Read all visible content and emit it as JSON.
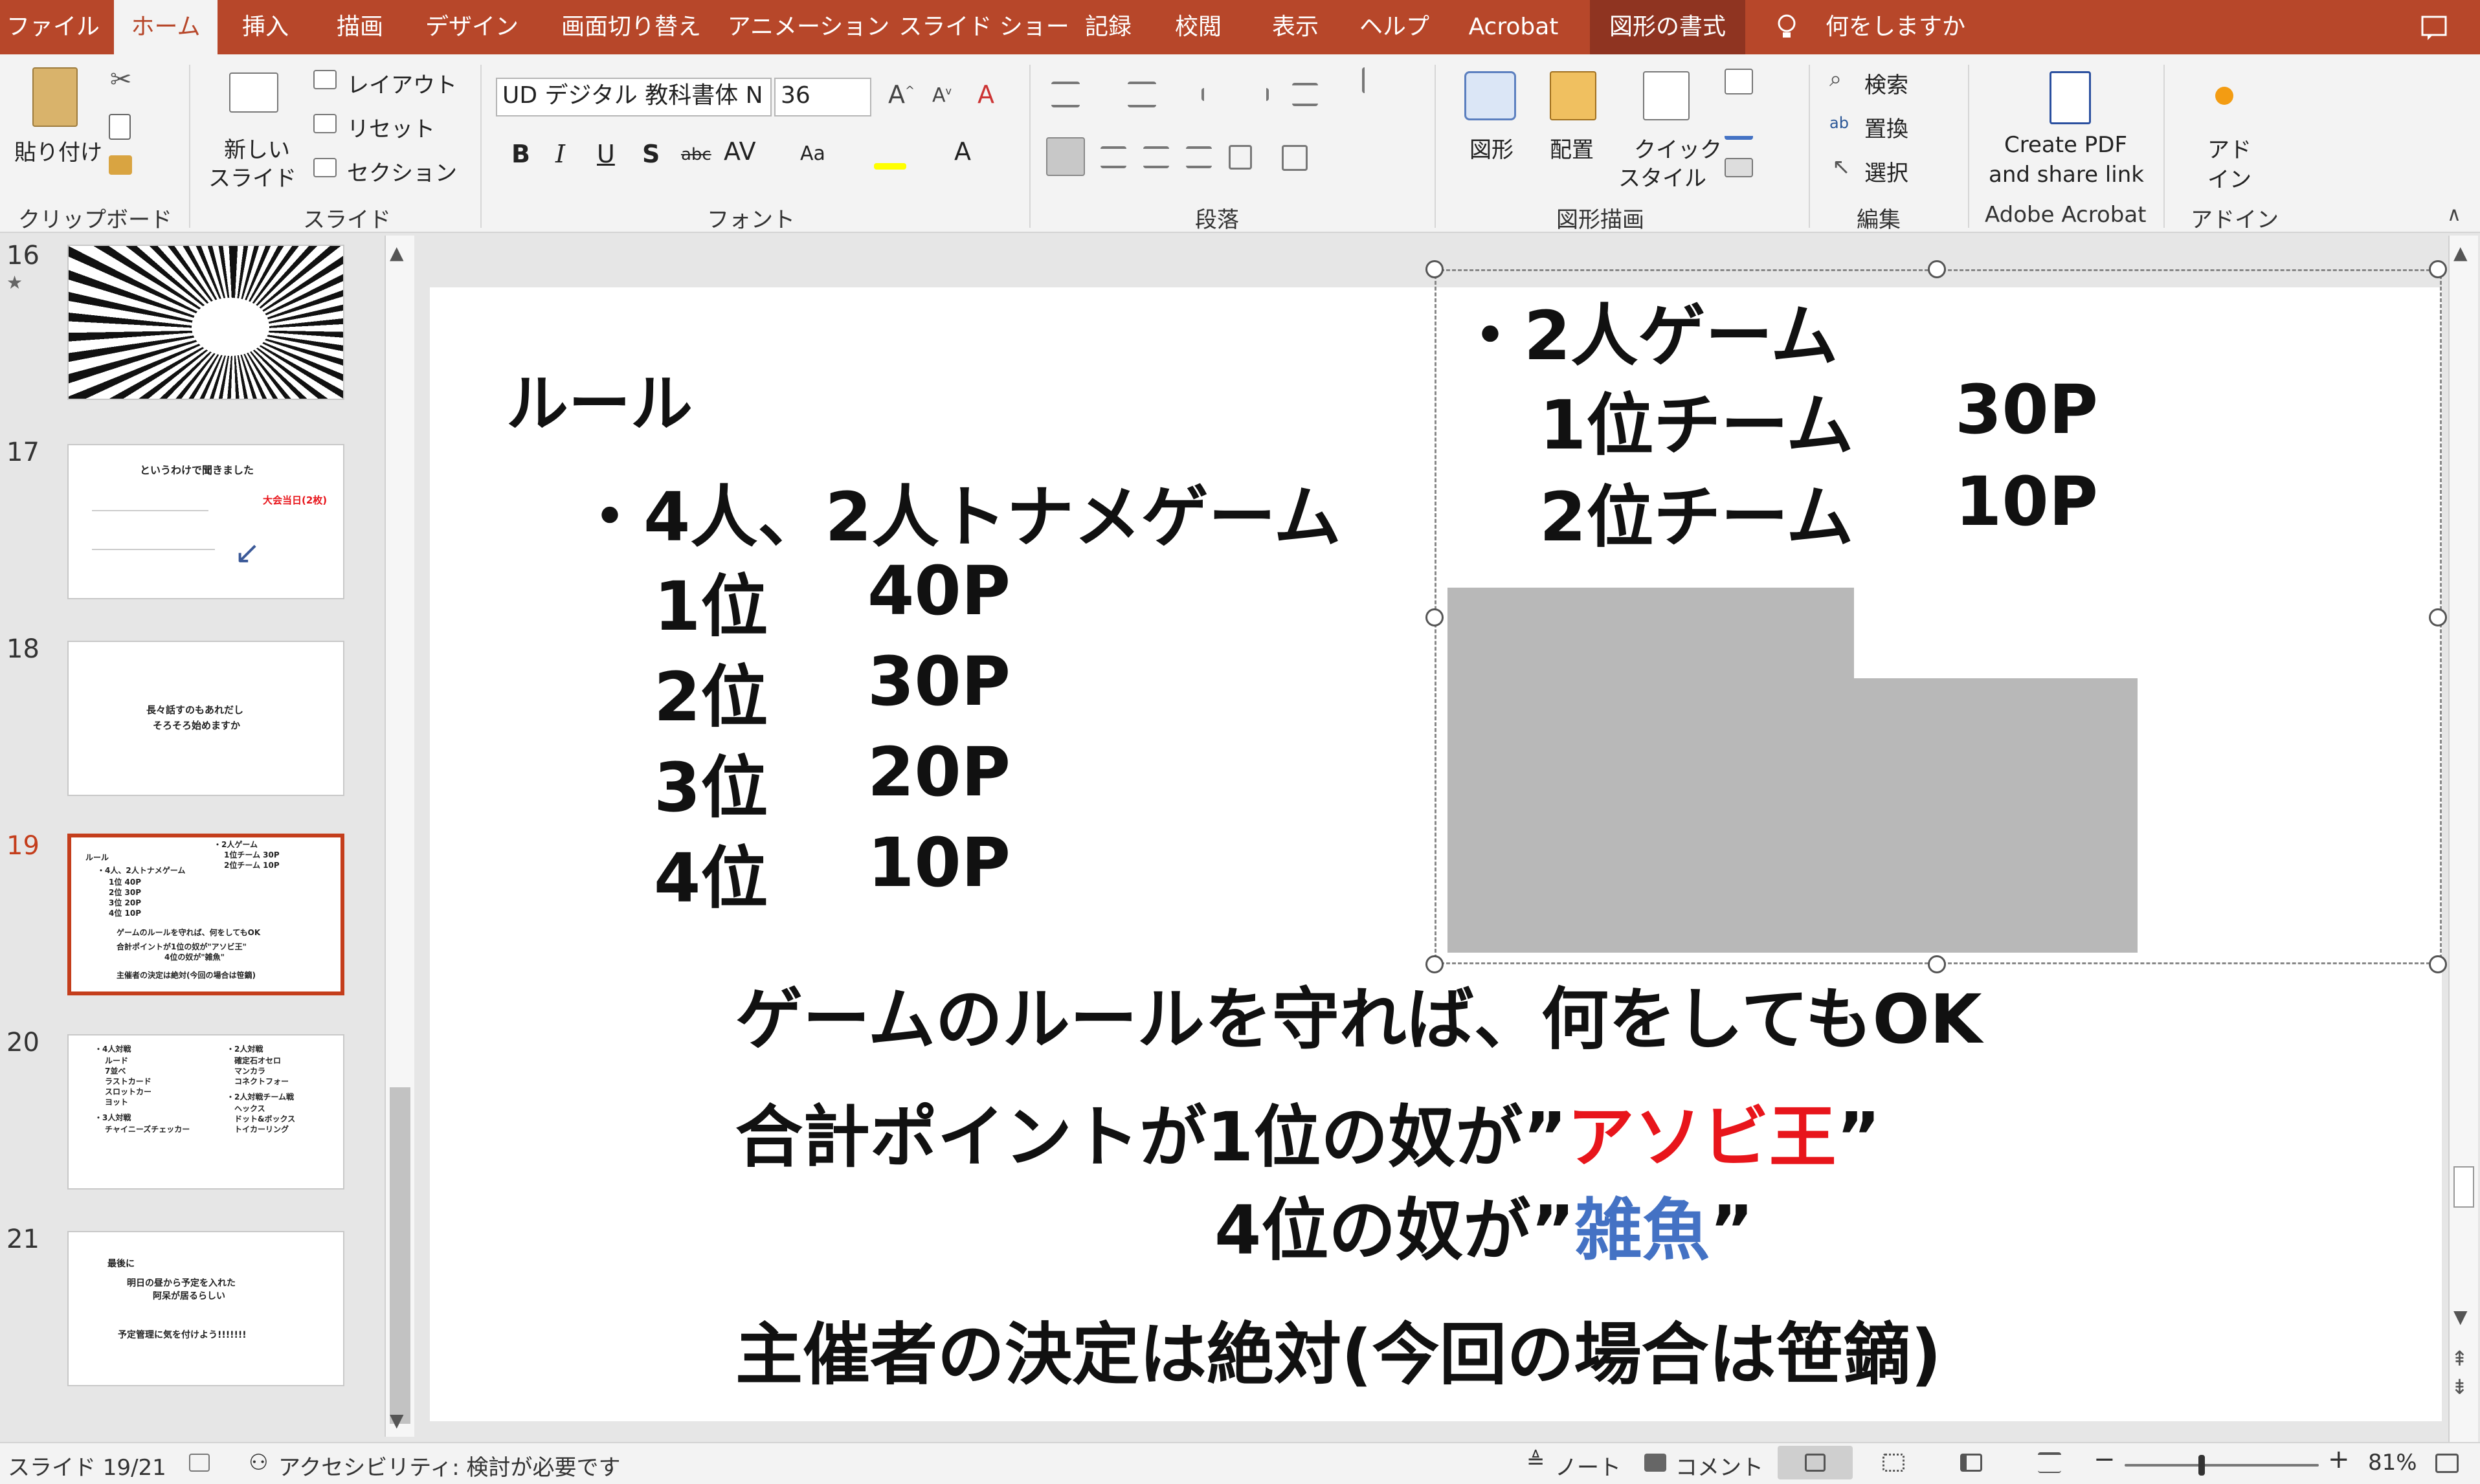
{
  "tabs": [
    "ファイル",
    "ホーム",
    "挿入",
    "描画",
    "デザイン",
    "画面切り替え",
    "アニメーション",
    "スライド ショー",
    "記録",
    "校閲",
    "表示",
    "ヘルプ",
    "Acrobat",
    "図形の書式"
  ],
  "tell_me": "何をしますか",
  "ribbon": {
    "clipboard": {
      "paste": "貼り付け",
      "label": "クリップボード"
    },
    "slides": {
      "new_slide_1": "新しい",
      "new_slide_2": "スライド",
      "layout": "レイアウト",
      "reset": "リセット",
      "section": "セクション",
      "label": "スライド"
    },
    "font": {
      "name": "UD デジタル 教科書体 N",
      "size": "36",
      "label": "フォント"
    },
    "paragraph": {
      "label": "段落"
    },
    "drawing": {
      "shape": "図形",
      "arrange": "配置",
      "quick_1": "クイック",
      "quick_2": "スタイル",
      "label": "図形描画"
    },
    "editing": {
      "find": "検索",
      "replace": "置換",
      "select": "選択",
      "label": "編集"
    },
    "acrobat": {
      "line1": "Create PDF",
      "line2": "and share link",
      "label": "Adobe Acrobat"
    },
    "addin": {
      "line1": "アド",
      "line2": "イン",
      "label": "アドイン"
    }
  },
  "thumbnails": [
    {
      "num": "16"
    },
    {
      "num": "17",
      "title": "というわけで聞きました",
      "note": "大会当日(2枚)"
    },
    {
      "num": "18",
      "line1": "長々話すのもあれだし",
      "line2": "そろそろ始めますか"
    },
    {
      "num": "19",
      "lines": [
        "ルール",
        "・4人、2人トナメゲーム",
        "1位 40P",
        "2位 30P",
        "3位 20P",
        "4位 10P",
        "・2人ゲーム",
        "1位チーム 30P",
        "2位チーム 10P",
        "ゲームのルールを守れば、何をしてもOK",
        "合計ポイントが1位の奴が\"アソビ王\"",
        "4位の奴が\"雑魚\"",
        "主催者の決定は絶対(今回の場合は笹鏑)"
      ]
    },
    {
      "num": "20",
      "left": [
        "・4人対戦",
        "ルード",
        "7並べ",
        "ラストカード",
        "スロットカー",
        "ヨット",
        "・3人対戦",
        "チャイニーズチェッカー"
      ],
      "right": [
        "・2人対戦",
        "確定石オセロ",
        "マンカラ",
        "コネクトフォー",
        "・2人対戦チーム戦",
        "ヘックス",
        "ドット&ボックス",
        "トイカーリング"
      ]
    },
    {
      "num": "21",
      "lines": [
        "最後に",
        "明日の昼から予定を入れた",
        "阿呆が居るらしい",
        "予定管理に気を付けよう!!!!!!!"
      ]
    }
  ],
  "slide": {
    "rule": "ルール",
    "four_two": "・4人、2人トナメゲーム",
    "ranks": [
      [
        "1位",
        "40P"
      ],
      [
        "2位",
        "30P"
      ],
      [
        "3位",
        "20P"
      ],
      [
        "4位",
        "10P"
      ]
    ],
    "two_game": "・2人ゲーム",
    "teams": [
      [
        "1位チーム",
        "30P"
      ],
      [
        "2位チーム",
        "10P"
      ]
    ],
    "line_ok": "ゲームのルールを守れば、何をしてもOK",
    "line_king_pre": "合計ポイントが1位の奴が”",
    "line_king_word": "アソビ王",
    "line_king_post": "”",
    "line_zako_pre": "4位の奴が”",
    "line_zako_word": "雑魚",
    "line_zako_post": "”",
    "line_host": "主催者の決定は絶対(今回の場合は笹鏑)",
    "colors": {
      "red": "#e8151b",
      "blue": "#4472c4"
    }
  },
  "status": {
    "slide": "スライド 19/21",
    "accessibility": "アクセシビリティ: 検討が必要です",
    "notes": "ノート",
    "comments": "コメント",
    "zoom": "81%"
  }
}
